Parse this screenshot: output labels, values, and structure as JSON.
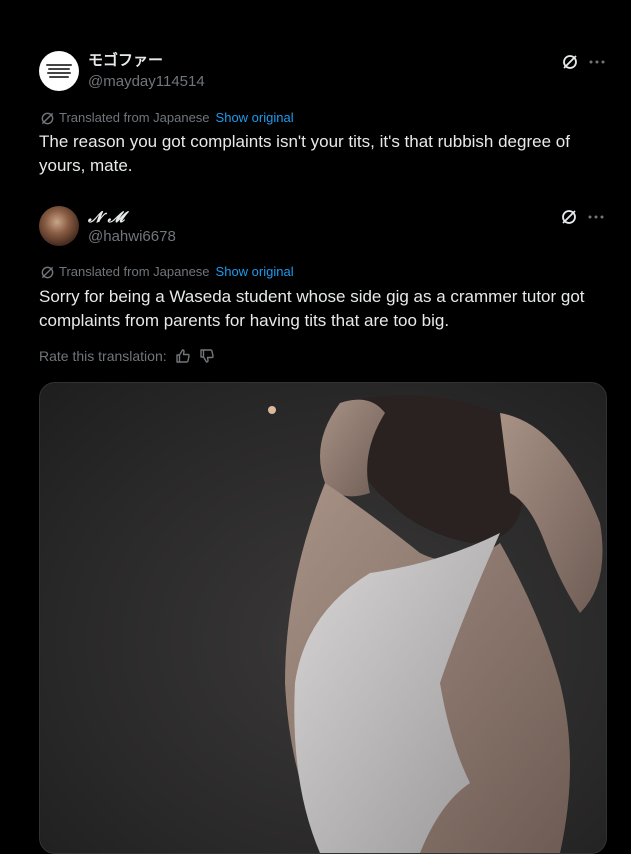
{
  "posts": [
    {
      "display_name": "モゴファー",
      "handle": "@mayday114514",
      "translated_label": "Translated from Japanese",
      "show_original": "Show original",
      "text": "The reason you got complaints isn't your tits, it's that rubbish degree of yours, mate."
    },
    {
      "display_name": "𝓝 𝓜",
      "handle": "@hahwi6678",
      "translated_label": "Translated from Japanese",
      "show_original": "Show original",
      "text": "Sorry for being a Waseda student whose side gig as a crammer tutor got complaints from parents for having tits that are too big.",
      "rate_label": "Rate this translation:"
    }
  ],
  "icons": {
    "grok": "grok-icon",
    "more": "more-icon",
    "translate": "translate-icon",
    "thumbs_up": "thumbs-up-icon",
    "thumbs_down": "thumbs-down-icon"
  },
  "colors": {
    "background": "#000000",
    "text": "#e7e9ea",
    "secondary": "#71767b",
    "link": "#1d9bf0"
  }
}
